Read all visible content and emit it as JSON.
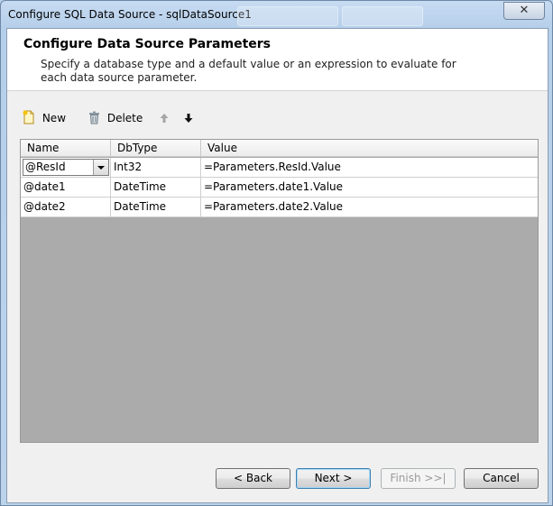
{
  "window": {
    "title": "Configure SQL Data Source - sqlDataSource1",
    "close_glyph": "✕"
  },
  "header": {
    "title": "Configure Data Source Parameters",
    "description": "Specify a database type and a default value or an expression to evaluate for each data source parameter."
  },
  "toolbar": {
    "new_label": "New",
    "delete_label": "Delete",
    "new_icon": "new-document-icon",
    "delete_icon": "trash-icon",
    "move_up_icon": "arrow-up-icon",
    "move_down_icon": "arrow-down-icon"
  },
  "grid": {
    "columns": [
      "Name",
      "DbType",
      "Value"
    ],
    "rows": [
      {
        "name": "@ResId",
        "dbtype": "Int32",
        "value": "=Parameters.ResId.Value"
      },
      {
        "name": "@date1",
        "dbtype": "DateTime",
        "value": "=Parameters.date1.Value"
      },
      {
        "name": "@date2",
        "dbtype": "DateTime",
        "value": "=Parameters.date2.Value"
      }
    ]
  },
  "buttons": {
    "back": "< Back",
    "next": "Next >",
    "finish": "Finish >>|",
    "cancel": "Cancel"
  },
  "colors": {
    "grid_background": "#ababab",
    "header_background": "#ffffff",
    "dialog_background": "#f0f0f0"
  }
}
